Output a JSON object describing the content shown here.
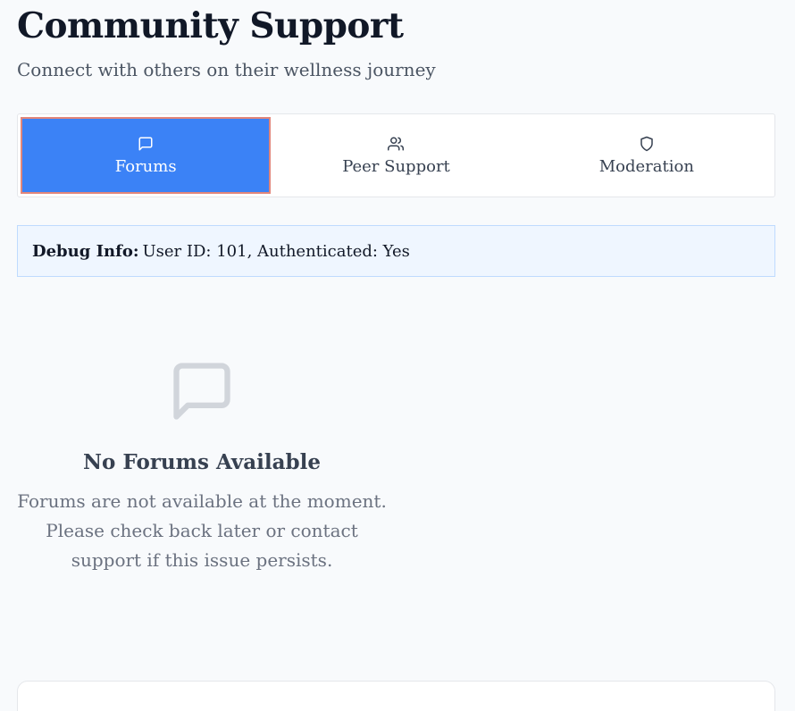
{
  "header": {
    "title": "Community Support",
    "subtitle": "Connect with others on their wellness journey"
  },
  "tabs": [
    {
      "label": "Forums",
      "icon": "message-square-icon",
      "active": true
    },
    {
      "label": "Peer Support",
      "icon": "users-icon",
      "active": false
    },
    {
      "label": "Moderation",
      "icon": "shield-icon",
      "active": false
    }
  ],
  "debug": {
    "key": "Debug Info:",
    "value": "User ID: 101, Authenticated: Yes"
  },
  "empty_state": {
    "icon": "message-square-icon",
    "title": "No Forums Available",
    "message": "Forums are not available at the moment. Please check back later or contact support if this issue persists."
  },
  "colors": {
    "accent": "#3b82f6",
    "active_tab_border": "#e2867a",
    "debug_bg": "#eff6ff",
    "page_bg": "#f8fafc"
  }
}
